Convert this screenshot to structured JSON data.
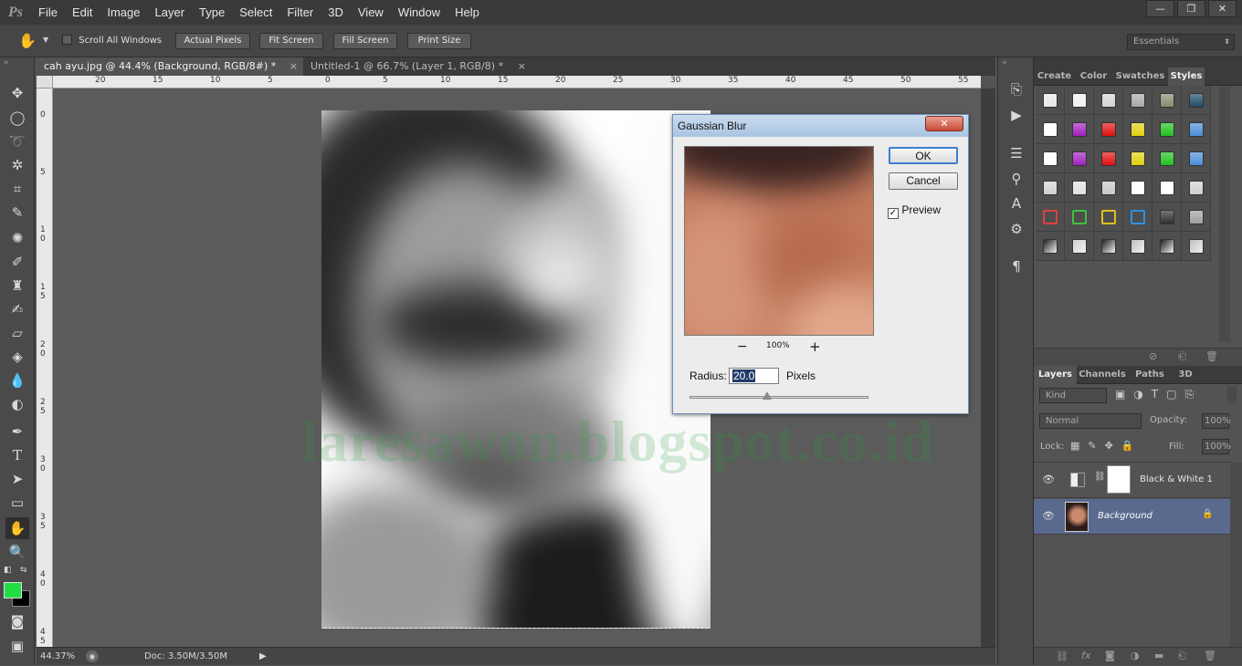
{
  "menubar": {
    "logo": "Ps",
    "items": [
      "File",
      "Edit",
      "Image",
      "Layer",
      "Type",
      "Select",
      "Filter",
      "3D",
      "View",
      "Window",
      "Help"
    ],
    "window_controls": [
      "—",
      "❐",
      "✕"
    ]
  },
  "options": {
    "scroll_all_label": "Scroll All Windows",
    "buttons": [
      "Actual Pixels",
      "Fit Screen",
      "Fill Screen",
      "Print Size"
    ],
    "workspace": "Essentials"
  },
  "tabs": [
    {
      "label": "cah ayu.jpg @ 44.4% (Background, RGB/8#) *",
      "active": true
    },
    {
      "label": "Untitled-1 @ 66.7% (Layer 1, RGB/8) *",
      "active": false
    }
  ],
  "ruler": {
    "h_ticks": [
      "20",
      "15",
      "10",
      "5",
      "0",
      "5",
      "10",
      "15",
      "20",
      "25",
      "30",
      "35",
      "40",
      "45",
      "50",
      "55"
    ],
    "v_ticks": [
      "0",
      "5",
      "1\n0",
      "1\n5",
      "2\n0",
      "2\n5",
      "3\n0",
      "3\n5",
      "4\n0",
      "4\n5"
    ]
  },
  "canvas": {
    "watermark": "laresawon.blogspot.co.id"
  },
  "status": {
    "zoom": "44.37%",
    "doc": "Doc: 3.50M/3.50M"
  },
  "dialog": {
    "title": "Gaussian Blur",
    "ok": "OK",
    "cancel": "Cancel",
    "preview_label": "Preview",
    "preview_checked": true,
    "zoom_minus": "−",
    "zoom_pct": "100%",
    "zoom_plus": "+",
    "radius_label": "Radius:",
    "radius_value": "20.0",
    "radius_unit": "Pixels"
  },
  "styles_panel": {
    "tabs": [
      "Create",
      "Color",
      "Swatches",
      "Styles"
    ],
    "active_tab": "Styles"
  },
  "layers_panel": {
    "tabs": [
      "Layers",
      "Channels",
      "Paths",
      "3D"
    ],
    "active_tab": "Layers",
    "kind": "Kind",
    "blend_mode": "Normal",
    "opacity_label": "Opacity:",
    "opacity": "100%",
    "lock_label": "Lock:",
    "fill_label": "Fill:",
    "fill": "100%",
    "layers": [
      {
        "name": "Black & White 1",
        "selected": false
      },
      {
        "name": "Background",
        "selected": true
      }
    ]
  },
  "colors": {
    "foreground": "#22dd44",
    "background": "#000000",
    "accent_selected_layer": "#5a6a8e"
  }
}
